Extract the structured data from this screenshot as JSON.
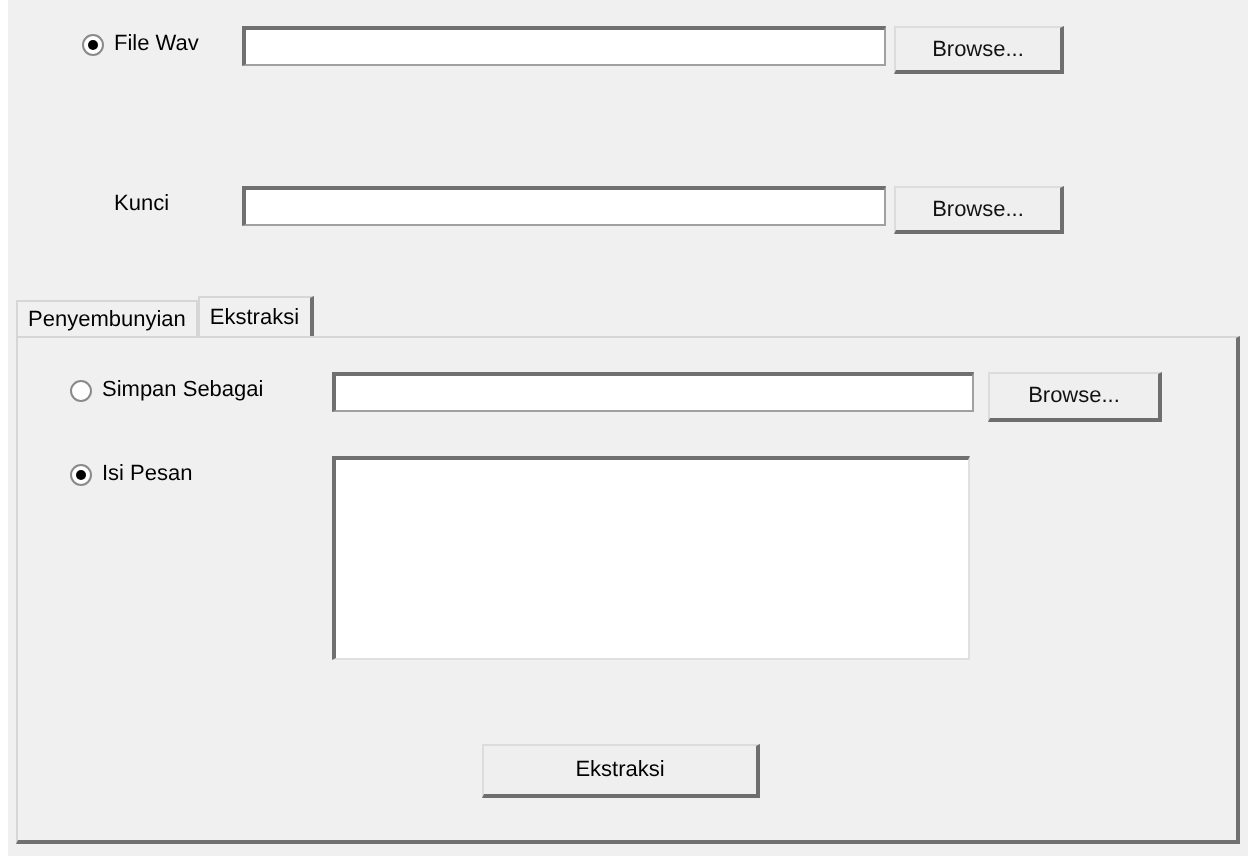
{
  "top_rows": [
    {
      "kind": "radio",
      "label": "File Wav",
      "selected": true,
      "button": "Browse..."
    },
    {
      "kind": "label",
      "label": "Kunci",
      "button": "Browse..."
    }
  ],
  "tabs": [
    {
      "label": "Penyembunyian",
      "selected": false
    },
    {
      "label": "Ekstraksi",
      "selected": true
    }
  ],
  "panel": {
    "save_option": {
      "label": "Simpan Sebagai",
      "selected": false,
      "button": "Browse..."
    },
    "message_option": {
      "label": "Isi Pesan",
      "selected": true
    },
    "action_button": "Ekstraksi"
  }
}
